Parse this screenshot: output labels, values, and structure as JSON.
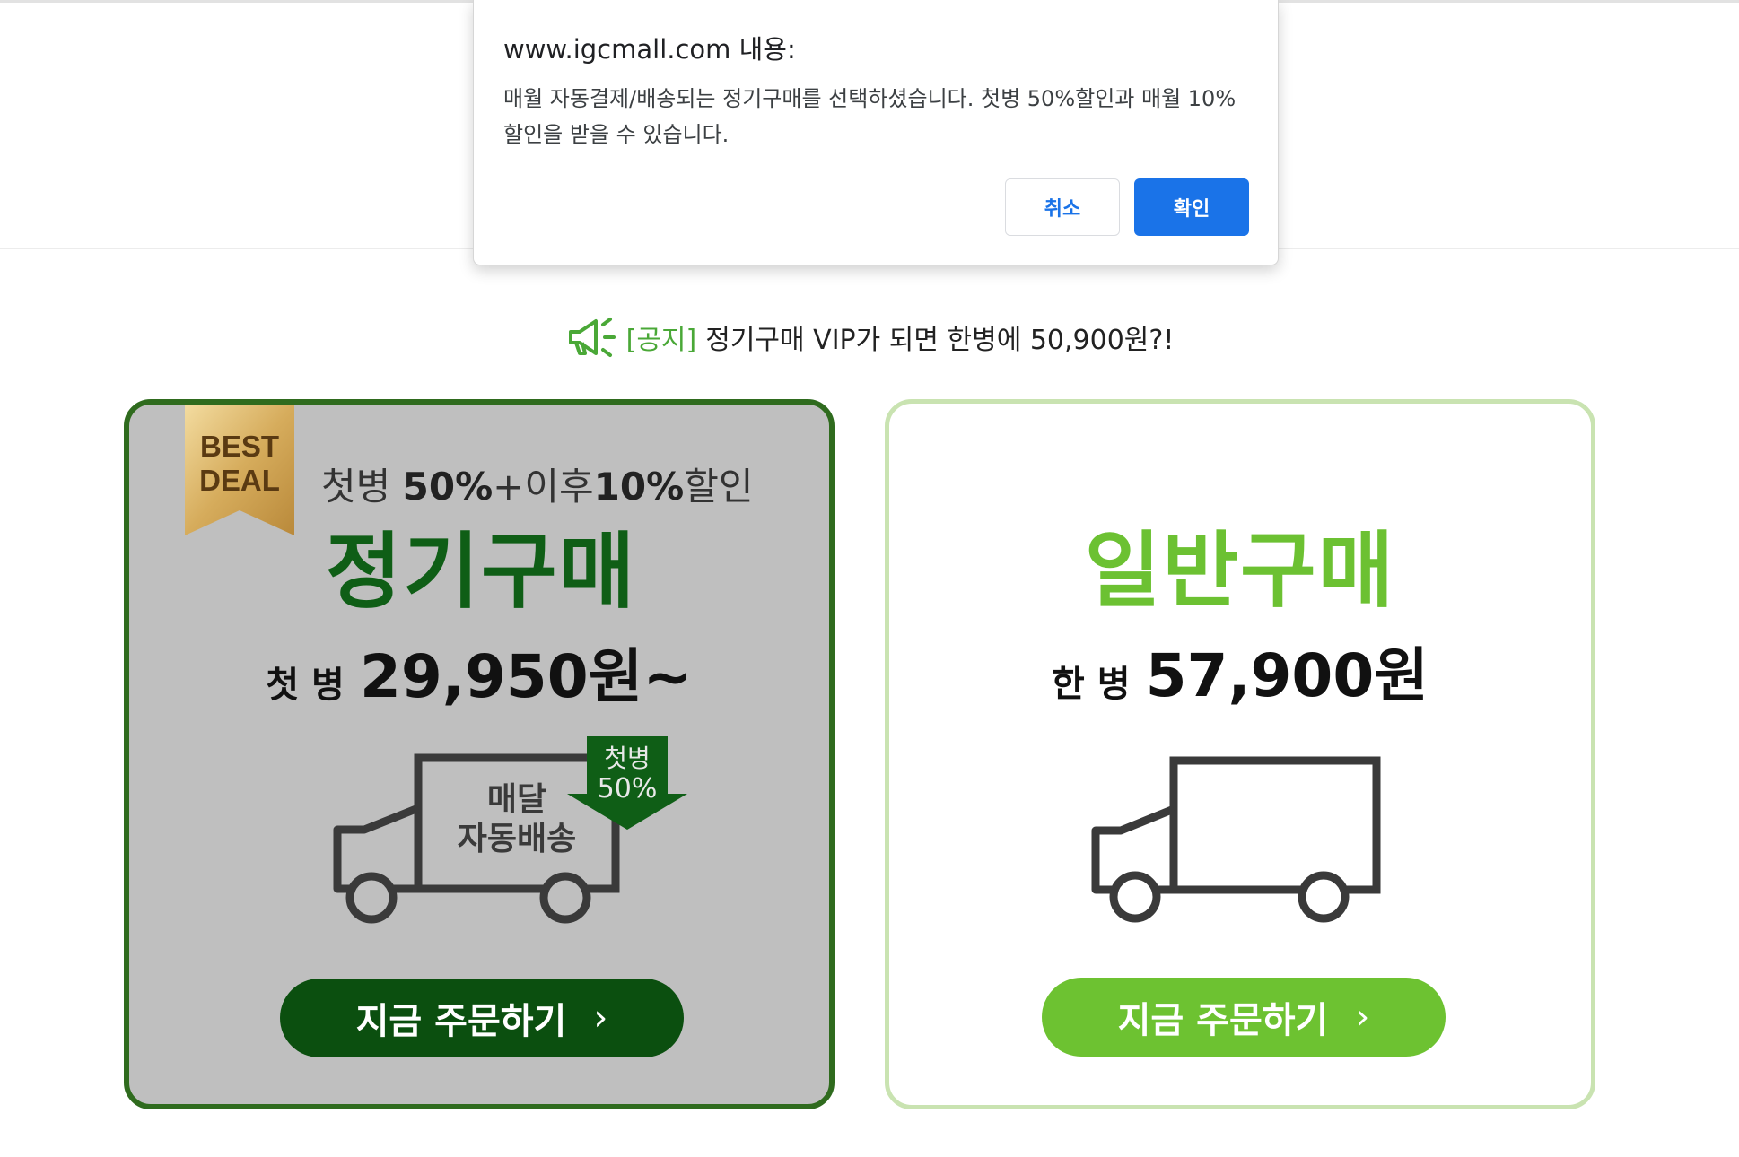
{
  "dialog": {
    "title": "www.igcmall.com 내용:",
    "message": "매월 자동결제/배송되는 정기구매를 선택하셨습니다. 첫병 50%할인과 매월 10% 할인을 받을 수 있습니다.",
    "cancel_label": "취소",
    "ok_label": "확인"
  },
  "notice": {
    "tag": "[공지]",
    "text": "정기구매 VIP가 되면 한병에 50,900원?!"
  },
  "subscription_card": {
    "badge": [
      "BEST",
      "DEAL"
    ],
    "headline_prefix": "첫병",
    "headline_first": "50%",
    "headline_mid": "+이후",
    "headline_second": "10%",
    "headline_suffix": "할인",
    "title": "정기구매",
    "price_prefix": "첫 병",
    "price": "29,950원~",
    "truck_label_1": "매달",
    "truck_label_2": "자동배송",
    "flag_line_1": "첫병",
    "flag_line_2": "50%",
    "cta_label": "지금 주문하기",
    "cta_chevron": "›"
  },
  "normal_card": {
    "title": "일반구매",
    "price_prefix": "한 병",
    "price": "57,900원",
    "cta_label": "지금 주문하기",
    "cta_chevron": "›"
  },
  "colors": {
    "subscription_title": "#0f5e16",
    "subscription_cta": "#0b4f0f",
    "normal_title": "#6cc132",
    "normal_cta": "#6dc231",
    "notice_tag": "#4aa837",
    "dialog_ok": "#1a73e8"
  },
  "icons": {
    "notice": "megaphone-icon",
    "badge": "ribbon-badge-icon",
    "truck": "truck-icon",
    "cta": "chevron-right-icon"
  }
}
